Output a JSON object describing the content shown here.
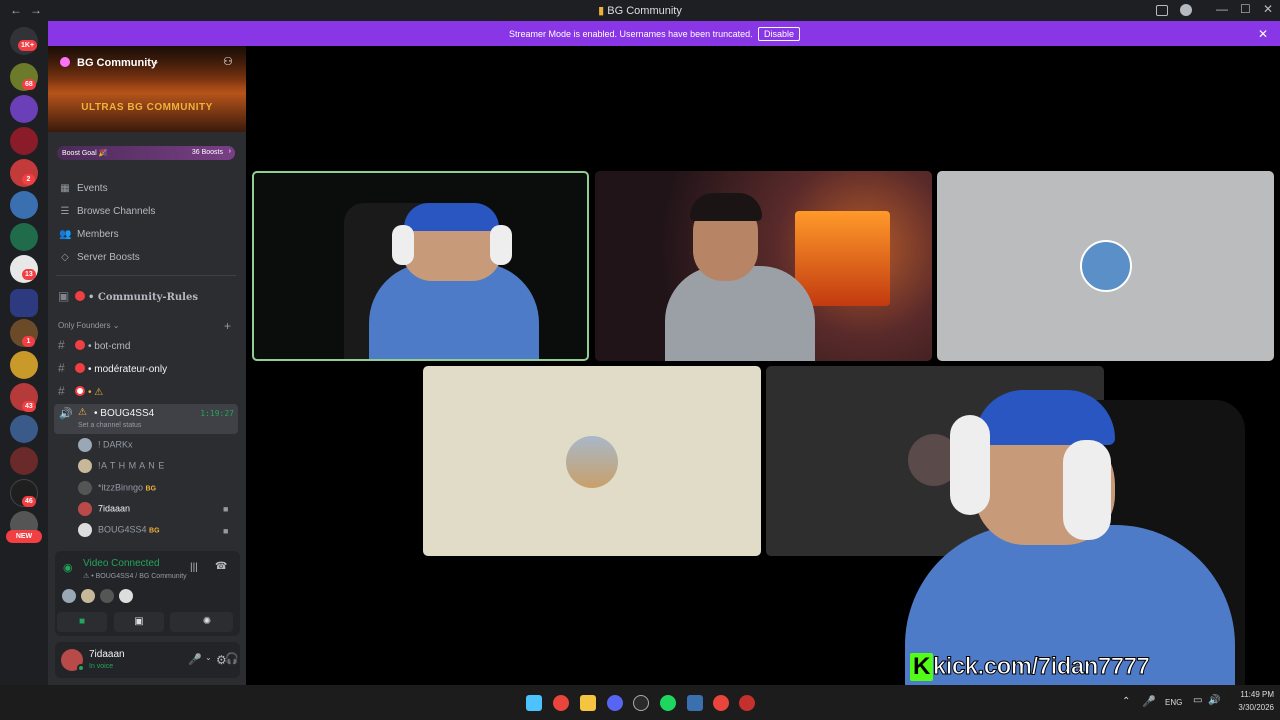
{
  "window": {
    "title": "BG Community",
    "nav_back": "←",
    "nav_forward": "→",
    "controls": [
      "—",
      "☐",
      "✕"
    ]
  },
  "rail": {
    "badges": [
      "1K+",
      "68",
      "2",
      "13",
      "1",
      "43",
      "46"
    ],
    "new_pill": "NEW"
  },
  "banner": {
    "message": "Streamer Mode is enabled. Usernames have been truncated.",
    "disable_label": "Disable",
    "close": "✕"
  },
  "server": {
    "name": "BG Community",
    "banner_text": "ULTRAS BG COMMUNITY",
    "boost_goal_label": "Boost Goal 🎉",
    "boost_count": "36 Boosts",
    "menu": [
      {
        "label": "Events",
        "icon": "calendar-icon"
      },
      {
        "label": "Browse Channels",
        "icon": "list-icon"
      },
      {
        "label": "Members",
        "icon": "members-icon"
      },
      {
        "label": "Server Boosts",
        "icon": "boost-icon"
      }
    ],
    "rules_channel": "• Community-Rules",
    "category": "Only Founders",
    "channels": [
      {
        "name": "• bot-cmd"
      },
      {
        "name": "• modérateur-only"
      },
      {
        "name": "• ⚠"
      }
    ],
    "voice_channel": {
      "name": "• BOUG4SS4",
      "timer": "1:19:27",
      "status_placeholder": "Set a channel status"
    },
    "voice_members": [
      {
        "name": "! DARKx",
        "tag": ""
      },
      {
        "name": "!A T H M A N E",
        "tag": ""
      },
      {
        "name": "*itzzBinngo",
        "tag": "BG"
      },
      {
        "name": "7idaaan",
        "tag": ""
      },
      {
        "name": "BOUG4SS4",
        "tag": "BG"
      }
    ]
  },
  "voice_panel": {
    "status": "Video Connected",
    "location": "⚠ • BOUG4SS4 / BG Community"
  },
  "user": {
    "name": "7idaaan",
    "status": "In voice"
  },
  "tiles": [
    {
      "label": "streamer-cam-1"
    },
    {
      "label": "streamer-cam-2"
    },
    {
      "label": "avatar-tile-1"
    },
    {
      "label": "avatar-tile-2"
    },
    {
      "label": "avatar-tile-3"
    }
  ],
  "overlay": {
    "kick_text": "kick.com/7idan7777",
    "kick_logo": "K"
  },
  "taskbar": {
    "lang": "ENG",
    "time": "11:49 PM",
    "date": "3/30/2026"
  },
  "colors": {
    "accent": "#8936e6",
    "voice_green": "#23a55a",
    "danger": "#f23f43"
  }
}
